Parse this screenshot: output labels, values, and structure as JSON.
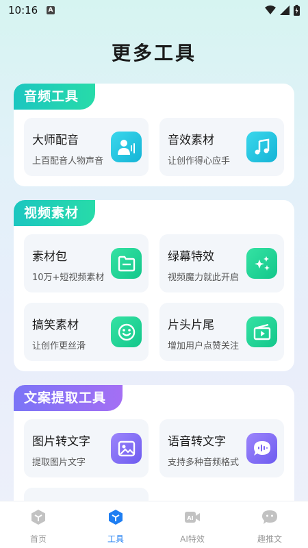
{
  "status": {
    "time": "10:16",
    "notif_badge": "A"
  },
  "page": {
    "title": "更多工具"
  },
  "sections": [
    {
      "title": "音频工具",
      "cards": [
        {
          "title": "大师配音",
          "desc": "上百配音人物声音",
          "icon": "voice-person-icon"
        },
        {
          "title": "音效素材",
          "desc": "让创作得心应手",
          "icon": "music-note-icon"
        }
      ]
    },
    {
      "title": "视频素材",
      "cards": [
        {
          "title": "素材包",
          "desc": "10万+短视频素材",
          "icon": "folder-icon"
        },
        {
          "title": "绿幕特效",
          "desc": "视频魔力就此开启",
          "icon": "stars-icon"
        },
        {
          "title": "搞笑素材",
          "desc": "让创作更丝滑",
          "icon": "smile-icon"
        },
        {
          "title": "片头片尾",
          "desc": "增加用户点赞关注",
          "icon": "video-clip-icon"
        }
      ]
    },
    {
      "title": "文案提取工具",
      "cards": [
        {
          "title": "图片转文字",
          "desc": "提取图片文字",
          "icon": "image-icon"
        },
        {
          "title": "语音转文字",
          "desc": "支持多种音频格式",
          "icon": "voice-wave-icon"
        }
      ]
    }
  ],
  "tabbar": {
    "active": 1,
    "tabs": [
      {
        "label": "首页",
        "icon": "home-cube-icon"
      },
      {
        "label": "工具",
        "icon": "tools-cube-icon"
      },
      {
        "label": "AI特效",
        "icon": "ai-camera-icon"
      },
      {
        "label": "趣推文",
        "icon": "chat-face-icon"
      }
    ]
  },
  "colors": {
    "accent_teal": "#1cc6c0",
    "accent_purple": "#7b74f6",
    "active_tab": "#1e7ef2"
  }
}
